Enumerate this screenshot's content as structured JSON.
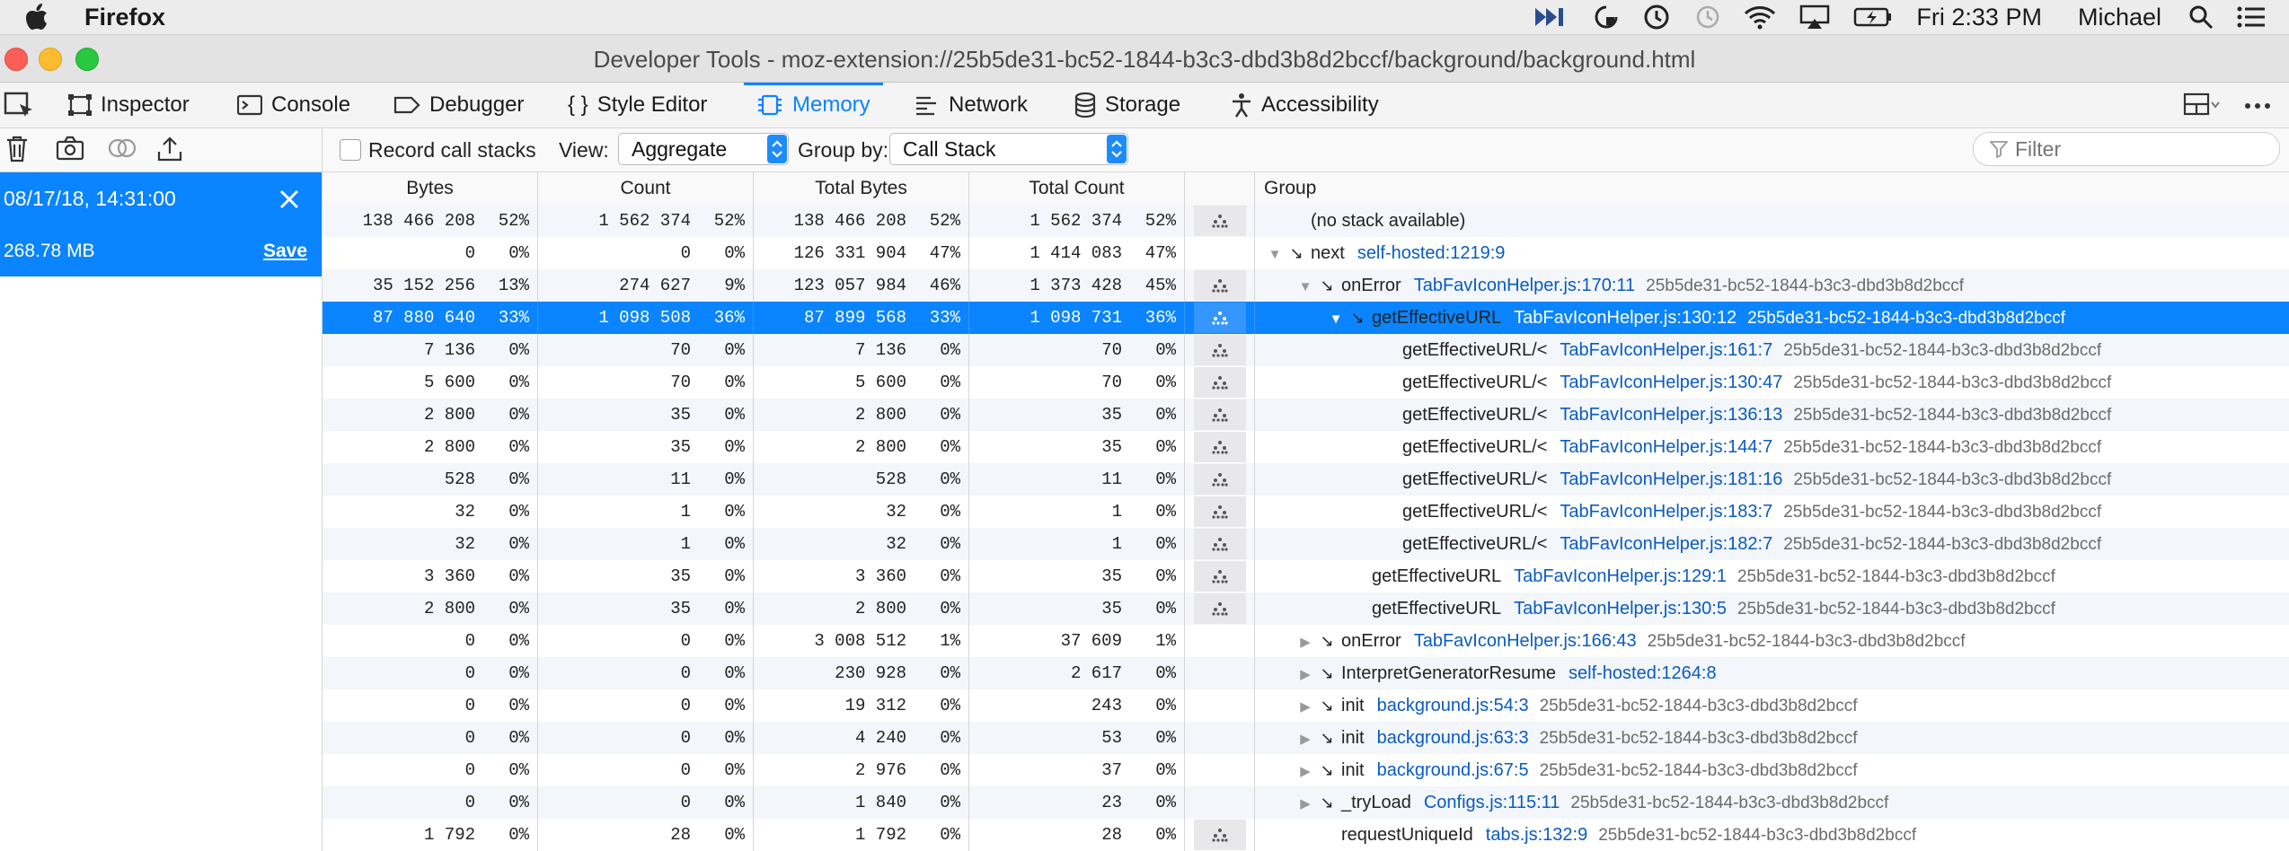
{
  "menubar": {
    "app_name": "Firefox",
    "clock": "Fri 2:33 PM",
    "user": "Michael"
  },
  "window": {
    "title": "Developer Tools - moz-extension://25b5de31-bc52-1844-b3c3-dbd3b8d2bccf/background/background.html"
  },
  "tabs": [
    {
      "label": "Inspector"
    },
    {
      "label": "Console"
    },
    {
      "label": "Debugger"
    },
    {
      "label": "Style Editor"
    },
    {
      "label": "Memory",
      "active": true
    },
    {
      "label": "Network"
    },
    {
      "label": "Storage"
    },
    {
      "label": "Accessibility"
    }
  ],
  "toolbar": {
    "record_label": "Record call stacks",
    "view_label": "View:",
    "view_value": "Aggregate",
    "group_label": "Group by:",
    "group_value": "Call Stack",
    "filter_placeholder": "Filter"
  },
  "snapshot": {
    "date": "08/17/18, 14:31:00",
    "size": "268.78 MB",
    "save_label": "Save"
  },
  "columns": {
    "bytes": "Bytes",
    "count": "Count",
    "total_bytes": "Total Bytes",
    "total_count": "Total Count",
    "group": "Group"
  },
  "rows": [
    {
      "bytes": "138 466 208",
      "bp": "52%",
      "count": "1 562 374",
      "cp": "52%",
      "tbytes": "138 466 208",
      "tbp": "52%",
      "tcount": "1 562 374",
      "tcp": "52%",
      "icon": true,
      "indent": 0,
      "twisty": "",
      "arrow": "",
      "fn": "(no stack available)",
      "src": "",
      "hash": ""
    },
    {
      "bytes": "0",
      "bp": "0%",
      "count": "0",
      "cp": "0%",
      "tbytes": "126 331 904",
      "tbp": "47%",
      "tcount": "1 414 083",
      "tcp": "47%",
      "icon": false,
      "indent": 0,
      "twisty": "▼",
      "arrow": "↘",
      "fn": "next",
      "src": "self-hosted:1219:9",
      "hash": ""
    },
    {
      "bytes": "35 152 256",
      "bp": "13%",
      "count": "274 627",
      "cp": "9%",
      "tbytes": "123 057 984",
      "tbp": "46%",
      "tcount": "1 373 428",
      "tcp": "45%",
      "icon": true,
      "indent": 1,
      "twisty": "▼",
      "arrow": "↘",
      "fn": "onError",
      "src": "TabFavIconHelper.js:170:11",
      "hash": "25b5de31-bc52-1844-b3c3-dbd3b8d2bccf"
    },
    {
      "bytes": "87 880 640",
      "bp": "33%",
      "count": "1 098 508",
      "cp": "36%",
      "tbytes": "87 899 568",
      "tbp": "33%",
      "tcount": "1 098 731",
      "tcp": "36%",
      "icon": true,
      "indent": 2,
      "twisty": "▼",
      "arrow": "↘",
      "fn": "getEffectiveURL",
      "src": "TabFavIconHelper.js:130:12",
      "hash": "25b5de31-bc52-1844-b3c3-dbd3b8d2bccf",
      "selected": true
    },
    {
      "bytes": "7 136",
      "bp": "0%",
      "count": "70",
      "cp": "0%",
      "tbytes": "7 136",
      "tbp": "0%",
      "tcount": "70",
      "tcp": "0%",
      "icon": true,
      "indent": 3,
      "twisty": "",
      "arrow": "",
      "fn": "getEffectiveURL/<",
      "src": "TabFavIconHelper.js:161:7",
      "hash": "25b5de31-bc52-1844-b3c3-dbd3b8d2bccf"
    },
    {
      "bytes": "5 600",
      "bp": "0%",
      "count": "70",
      "cp": "0%",
      "tbytes": "5 600",
      "tbp": "0%",
      "tcount": "70",
      "tcp": "0%",
      "icon": true,
      "indent": 3,
      "twisty": "",
      "arrow": "",
      "fn": "getEffectiveURL/<",
      "src": "TabFavIconHelper.js:130:47",
      "hash": "25b5de31-bc52-1844-b3c3-dbd3b8d2bccf"
    },
    {
      "bytes": "2 800",
      "bp": "0%",
      "count": "35",
      "cp": "0%",
      "tbytes": "2 800",
      "tbp": "0%",
      "tcount": "35",
      "tcp": "0%",
      "icon": true,
      "indent": 3,
      "twisty": "",
      "arrow": "",
      "fn": "getEffectiveURL/<",
      "src": "TabFavIconHelper.js:136:13",
      "hash": "25b5de31-bc52-1844-b3c3-dbd3b8d2bccf"
    },
    {
      "bytes": "2 800",
      "bp": "0%",
      "count": "35",
      "cp": "0%",
      "tbytes": "2 800",
      "tbp": "0%",
      "tcount": "35",
      "tcp": "0%",
      "icon": true,
      "indent": 3,
      "twisty": "",
      "arrow": "",
      "fn": "getEffectiveURL/<",
      "src": "TabFavIconHelper.js:144:7",
      "hash": "25b5de31-bc52-1844-b3c3-dbd3b8d2bccf"
    },
    {
      "bytes": "528",
      "bp": "0%",
      "count": "11",
      "cp": "0%",
      "tbytes": "528",
      "tbp": "0%",
      "tcount": "11",
      "tcp": "0%",
      "icon": true,
      "indent": 3,
      "twisty": "",
      "arrow": "",
      "fn": "getEffectiveURL/<",
      "src": "TabFavIconHelper.js:181:16",
      "hash": "25b5de31-bc52-1844-b3c3-dbd3b8d2bccf"
    },
    {
      "bytes": "32",
      "bp": "0%",
      "count": "1",
      "cp": "0%",
      "tbytes": "32",
      "tbp": "0%",
      "tcount": "1",
      "tcp": "0%",
      "icon": true,
      "indent": 3,
      "twisty": "",
      "arrow": "",
      "fn": "getEffectiveURL/<",
      "src": "TabFavIconHelper.js:183:7",
      "hash": "25b5de31-bc52-1844-b3c3-dbd3b8d2bccf"
    },
    {
      "bytes": "32",
      "bp": "0%",
      "count": "1",
      "cp": "0%",
      "tbytes": "32",
      "tbp": "0%",
      "tcount": "1",
      "tcp": "0%",
      "icon": true,
      "indent": 3,
      "twisty": "",
      "arrow": "",
      "fn": "getEffectiveURL/<",
      "src": "TabFavIconHelper.js:182:7",
      "hash": "25b5de31-bc52-1844-b3c3-dbd3b8d2bccf"
    },
    {
      "bytes": "3 360",
      "bp": "0%",
      "count": "35",
      "cp": "0%",
      "tbytes": "3 360",
      "tbp": "0%",
      "tcount": "35",
      "tcp": "0%",
      "icon": true,
      "indent": 2,
      "twisty": "",
      "arrow": "",
      "fn": "getEffectiveURL",
      "src": "TabFavIconHelper.js:129:1",
      "hash": "25b5de31-bc52-1844-b3c3-dbd3b8d2bccf"
    },
    {
      "bytes": "2 800",
      "bp": "0%",
      "count": "35",
      "cp": "0%",
      "tbytes": "2 800",
      "tbp": "0%",
      "tcount": "35",
      "tcp": "0%",
      "icon": true,
      "indent": 2,
      "twisty": "",
      "arrow": "",
      "fn": "getEffectiveURL",
      "src": "TabFavIconHelper.js:130:5",
      "hash": "25b5de31-bc52-1844-b3c3-dbd3b8d2bccf"
    },
    {
      "bytes": "0",
      "bp": "0%",
      "count": "0",
      "cp": "0%",
      "tbytes": "3 008 512",
      "tbp": "1%",
      "tcount": "37 609",
      "tcp": "1%",
      "icon": false,
      "indent": 1,
      "twisty": "▶",
      "arrow": "↘",
      "fn": "onError",
      "src": "TabFavIconHelper.js:166:43",
      "hash": "25b5de31-bc52-1844-b3c3-dbd3b8d2bccf"
    },
    {
      "bytes": "0",
      "bp": "0%",
      "count": "0",
      "cp": "0%",
      "tbytes": "230 928",
      "tbp": "0%",
      "tcount": "2 617",
      "tcp": "0%",
      "icon": false,
      "indent": 1,
      "twisty": "▶",
      "arrow": "↘",
      "fn": "InterpretGeneratorResume",
      "src": "self-hosted:1264:8",
      "hash": ""
    },
    {
      "bytes": "0",
      "bp": "0%",
      "count": "0",
      "cp": "0%",
      "tbytes": "19 312",
      "tbp": "0%",
      "tcount": "243",
      "tcp": "0%",
      "icon": false,
      "indent": 1,
      "twisty": "▶",
      "arrow": "↘",
      "fn": "init",
      "src": "background.js:54:3",
      "hash": "25b5de31-bc52-1844-b3c3-dbd3b8d2bccf"
    },
    {
      "bytes": "0",
      "bp": "0%",
      "count": "0",
      "cp": "0%",
      "tbytes": "4 240",
      "tbp": "0%",
      "tcount": "53",
      "tcp": "0%",
      "icon": false,
      "indent": 1,
      "twisty": "▶",
      "arrow": "↘",
      "fn": "init",
      "src": "background.js:63:3",
      "hash": "25b5de31-bc52-1844-b3c3-dbd3b8d2bccf"
    },
    {
      "bytes": "0",
      "bp": "0%",
      "count": "0",
      "cp": "0%",
      "tbytes": "2 976",
      "tbp": "0%",
      "tcount": "37",
      "tcp": "0%",
      "icon": false,
      "indent": 1,
      "twisty": "▶",
      "arrow": "↘",
      "fn": "init",
      "src": "background.js:67:5",
      "hash": "25b5de31-bc52-1844-b3c3-dbd3b8d2bccf"
    },
    {
      "bytes": "0",
      "bp": "0%",
      "count": "0",
      "cp": "0%",
      "tbytes": "1 840",
      "tbp": "0%",
      "tcount": "23",
      "tcp": "0%",
      "icon": false,
      "indent": 1,
      "twisty": "▶",
      "arrow": "↘",
      "fn": "_tryLoad",
      "src": "Configs.js:115:11",
      "hash": "25b5de31-bc52-1844-b3c3-dbd3b8d2bccf"
    },
    {
      "bytes": "1 792",
      "bp": "0%",
      "count": "28",
      "cp": "0%",
      "tbytes": "1 792",
      "tbp": "0%",
      "tcount": "28",
      "tcp": "0%",
      "icon": true,
      "indent": 1,
      "twisty": "",
      "arrow": "",
      "fn": "requestUniqueId",
      "src": "tabs.js:132:9",
      "hash": "25b5de31-bc52-1844-b3c3-dbd3b8d2bccf"
    }
  ]
}
